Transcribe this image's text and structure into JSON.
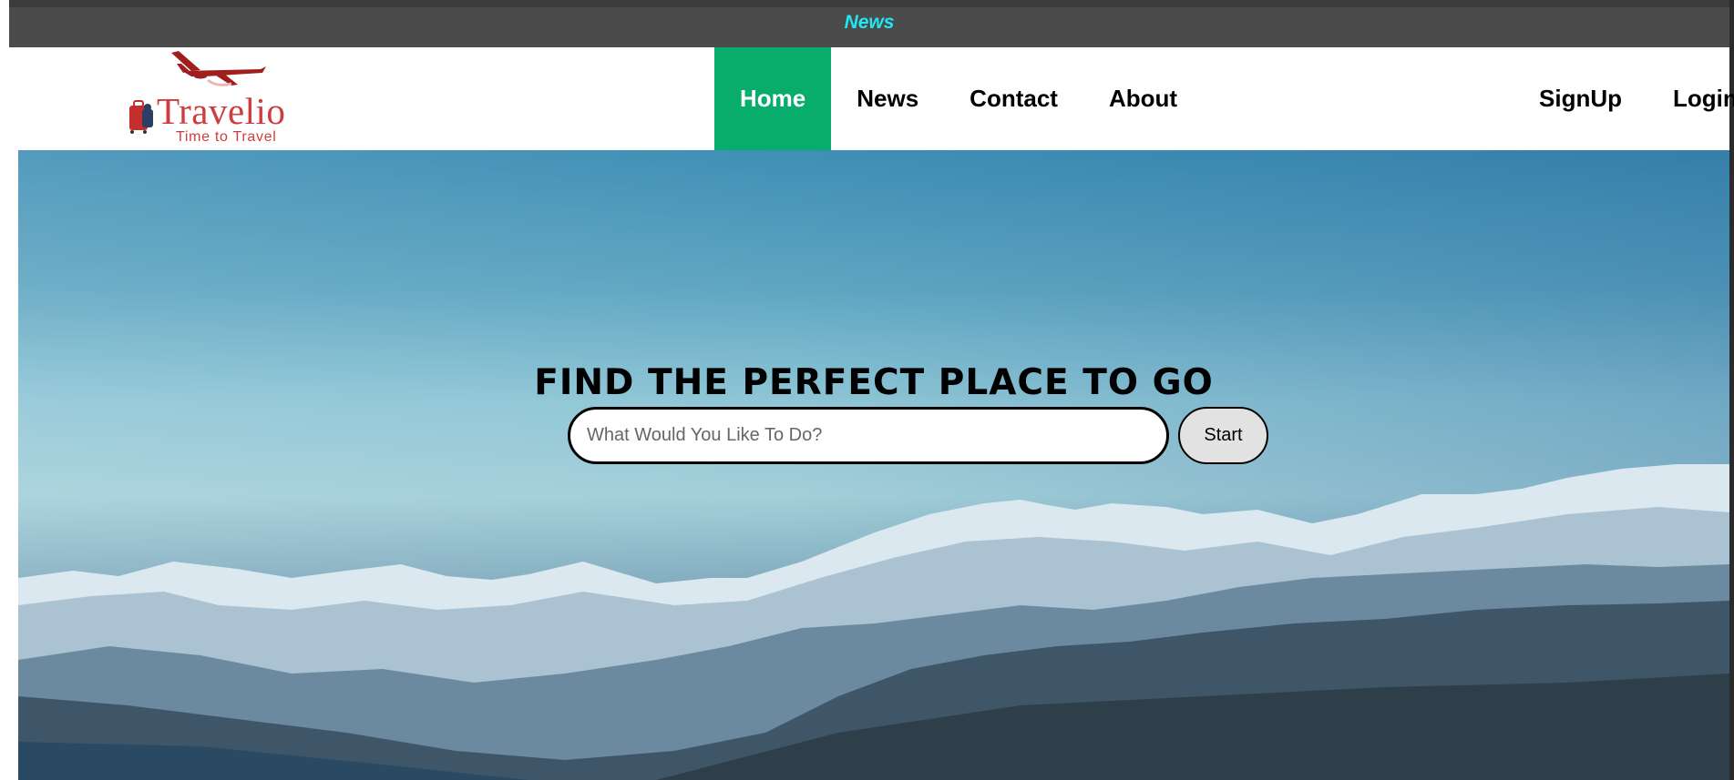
{
  "news_bar": {
    "link_label": "News"
  },
  "brand": {
    "name": "Travelio",
    "tagline": "Time to Travel",
    "color": "#cf3c3c"
  },
  "nav": {
    "items": [
      {
        "label": "Home",
        "active": true
      },
      {
        "label": "News"
      },
      {
        "label": "Contact"
      },
      {
        "label": "About"
      }
    ],
    "auth": [
      {
        "label": "SignUp"
      },
      {
        "label": "Login"
      }
    ],
    "active_color": "#08ad6c"
  },
  "hero": {
    "title": "FIND THE PERFECT PLACE TO GO",
    "search": {
      "placeholder": "What Would You Like To Do?",
      "value": ""
    },
    "start_label": "Start"
  }
}
